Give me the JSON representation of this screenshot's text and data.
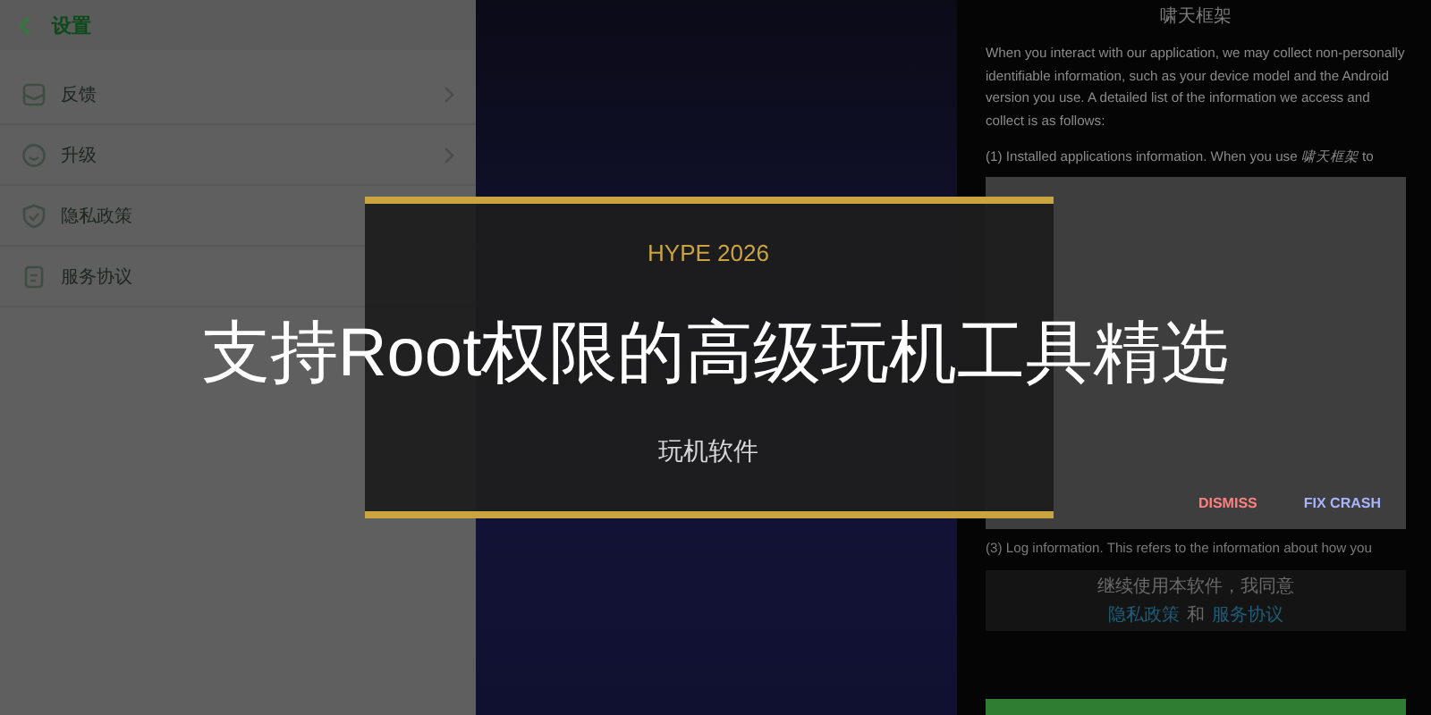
{
  "settings_screen": {
    "title": "设置",
    "items": [
      {
        "label": "反馈",
        "kind": "feedback",
        "has_arrow": true
      },
      {
        "label": "升级",
        "kind": "upgrade",
        "has_arrow": true
      },
      {
        "label": "隐私政策",
        "kind": "privacy",
        "has_arrow": false
      },
      {
        "label": "服务协议",
        "kind": "terms",
        "has_arrow": false
      }
    ]
  },
  "privacy_screen": {
    "title": "啸天框架",
    "paragraphs": [
      "When you interact with our application, we may collect non-personally identifiable information, such as your device model and the Android version you use. A detailed list of the information we access and collect is as follows:",
      "(1) Installed applications information. When you use *啸天框架* to"
    ],
    "dialog": {
      "buttons": [
        {
          "label": "DISMISS",
          "kind": "negative"
        },
        {
          "label": "FIX CRASH",
          "kind": "positive"
        }
      ]
    },
    "log_line": "(3) Log information. This refers to the information about how you",
    "consent": {
      "text": "继续使用本软件，我同意",
      "links": [
        "隐私政策",
        "服务协议"
      ],
      "joiner": "和"
    }
  },
  "banner": {
    "kicker": "HYPE 2026",
    "title": "支持Root权限的高级玩机工具精选",
    "category": "玩机软件"
  }
}
